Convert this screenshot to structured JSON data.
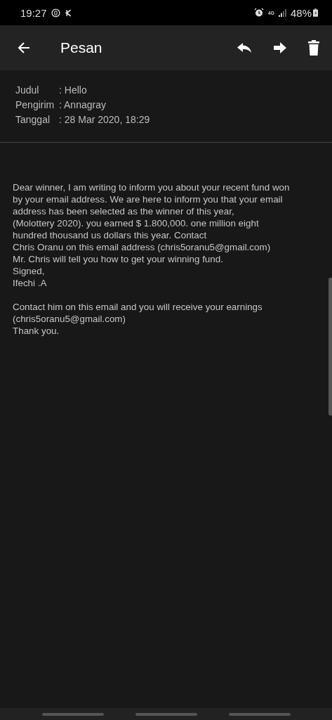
{
  "status_bar": {
    "time": "19:27",
    "network_type": "4G",
    "battery": "48%"
  },
  "app_bar": {
    "title": "Pesan"
  },
  "details": [
    {
      "label": "Judul",
      "value": ": Hello"
    },
    {
      "label": "Pengirim",
      "value": ": Annagray"
    },
    {
      "label": "Tanggal",
      "value": ": 28 Mar 2020, 18:29"
    }
  ],
  "message": {
    "paragraphs": [
      [
        "Dear winner, I am writing to inform you about your recent fund won",
        "by your email address. We are here to inform you that your email",
        "address has been selected as the winner of this year,",
        "(Molottery 2020). you earned $ 1.800,000. one million eight",
        "hundred thousand us dollars this year. Contact",
        "Chris Oranu on this email address (chris5oranu5@gmail.com)",
        "Mr. Chris will tell you how to get your winning fund.",
        "Signed,",
        "Ifechi .A"
      ],
      [
        "Contact him on this email and you will receive your earnings",
        "(chris5oranu5@gmail.com)",
        "Thank you."
      ]
    ]
  }
}
